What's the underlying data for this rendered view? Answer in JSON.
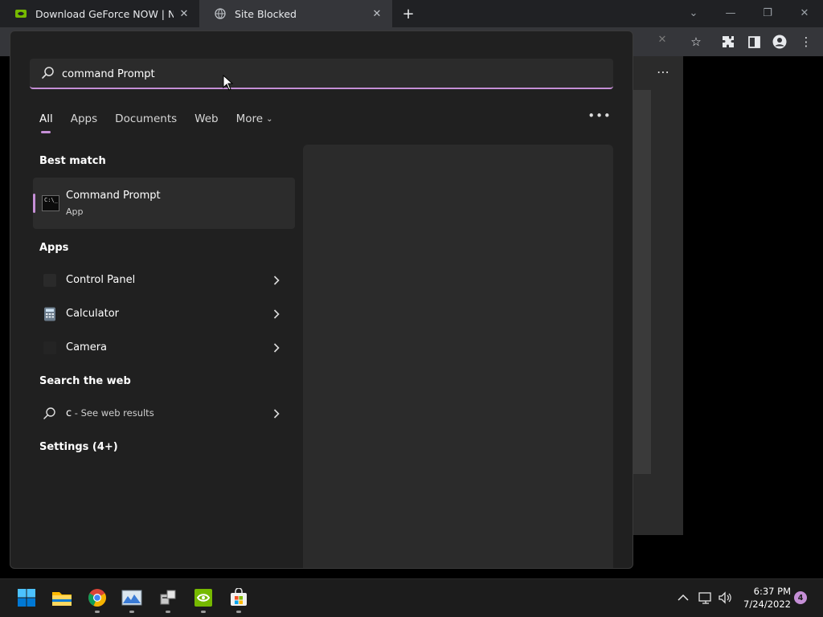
{
  "browser": {
    "tabs": [
      {
        "title": "Download GeForce NOW | NVIDIA",
        "close": "✕"
      },
      {
        "title": "Site Blocked",
        "close": "✕"
      }
    ],
    "new_tab": "+",
    "window_controls": {
      "tabsearch": "⌄",
      "minimize": "—",
      "restore": "❐",
      "close": "✕"
    },
    "toolbar": {
      "star": "☆",
      "extensions": "✱",
      "sidepanel": "◨",
      "profile": "●",
      "menu": "⋮"
    },
    "page_menu": "⋯"
  },
  "search": {
    "query": "command Prompt",
    "filters": [
      "All",
      "Apps",
      "Documents",
      "Web"
    ],
    "more_label": "More",
    "more_chevron": "⌄",
    "options": "•••",
    "close": "✕",
    "best_match": {
      "heading": "Best match",
      "title": "Command Prompt",
      "subtitle": "App",
      "icon_text": "C:\\_"
    },
    "apps": {
      "heading": "Apps",
      "items": [
        {
          "label": "Control Panel",
          "icon": "control-panel-icon"
        },
        {
          "label": "Calculator",
          "icon": "calculator-icon"
        },
        {
          "label": "Camera",
          "icon": "camera-icon"
        }
      ]
    },
    "web": {
      "heading": "Search the web",
      "query": "c",
      "suffix": " - See web results"
    },
    "settings": {
      "heading": "Settings (4+)"
    }
  },
  "taskbar": {
    "apps": [
      "start-icon",
      "file-explorer-icon",
      "chrome-icon",
      "photos-icon",
      "network-icon",
      "nvidia-icon",
      "store-icon"
    ],
    "tray": {
      "overflow": "^",
      "network": "▭",
      "volume": "🔈"
    },
    "time": "6:37 PM",
    "date": "7/24/2022",
    "notifications": "4"
  },
  "colors": {
    "accent": "#c58fd6",
    "flyout_bg": "#202020",
    "taskbar_bg": "#1c1c1c"
  }
}
